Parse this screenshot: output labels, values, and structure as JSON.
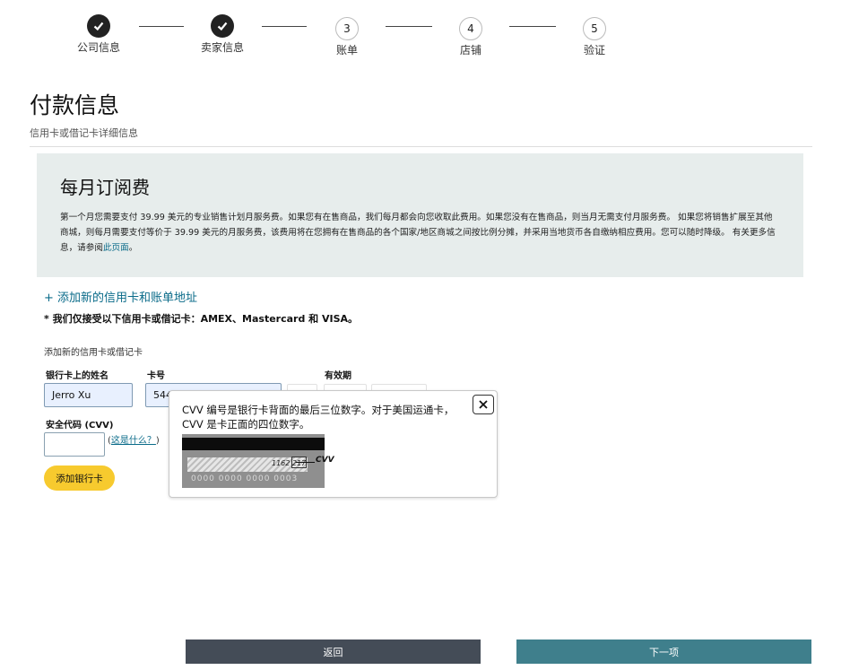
{
  "stepper": {
    "steps": [
      {
        "label": "公司信息",
        "state": "done",
        "icon": "check-icon"
      },
      {
        "label": "卖家信息",
        "state": "done",
        "icon": "check-icon"
      },
      {
        "label": "账单",
        "number": "3",
        "state": "todo"
      },
      {
        "label": "店铺",
        "number": "4",
        "state": "todo"
      },
      {
        "label": "验证",
        "number": "5",
        "state": "todo"
      }
    ]
  },
  "header": {
    "title": "付款信息",
    "subtitle": "信用卡或借记卡详细信息"
  },
  "fee": {
    "title": "每月订阅费",
    "text": "第一个月您需要支付 39.99 美元的专业销售计划月服务费。如果您有在售商品，我们每月都会向您收取此费用。如果您没有在售商品，则当月无需支付月服务费。 如果您将销售扩展至其他商城，则每月需要支付等价于 39.99 美元的月服务费，该费用将在您拥有在售商品的各个国家/地区商城之间按比例分摊，并采用当地货币各自缴纳相应费用。您可以随时降级。 有关更多信息，请参阅",
    "link": "此页面",
    "end": "。"
  },
  "card_form": {
    "add_link": "+ 添加新的信用卡和账单地址",
    "accept_note": "* 我们仅接受以下信用卡或借记卡：AMEX、Mastercard 和 VISA。",
    "section_title": "添加新的信用卡或借记卡",
    "name_label": "银行卡上的姓名",
    "name_value": "Jerro Xu",
    "number_label": "卡号",
    "number_value": "544",
    "expiry_label": "有效期",
    "cvv_label": "安全代码 (CVV)",
    "cvv_value": "",
    "cvv_help_open": "(",
    "cvv_help_link": "这是什么？",
    "cvv_help_close": ")",
    "add_button": "添加银行卡"
  },
  "popover": {
    "text": "CVV 编号是银行卡背面的最后三位数字。对于美国运通卡，CVV 是卡正面的四位数字。",
    "close_icon": "close-icon",
    "card_sig_digits": "1162 217",
    "card_number": "0000 0000 0000 0003",
    "cvv_tag": "CVV"
  },
  "footer": {
    "back_label": "返回",
    "next_label": "下一项"
  }
}
